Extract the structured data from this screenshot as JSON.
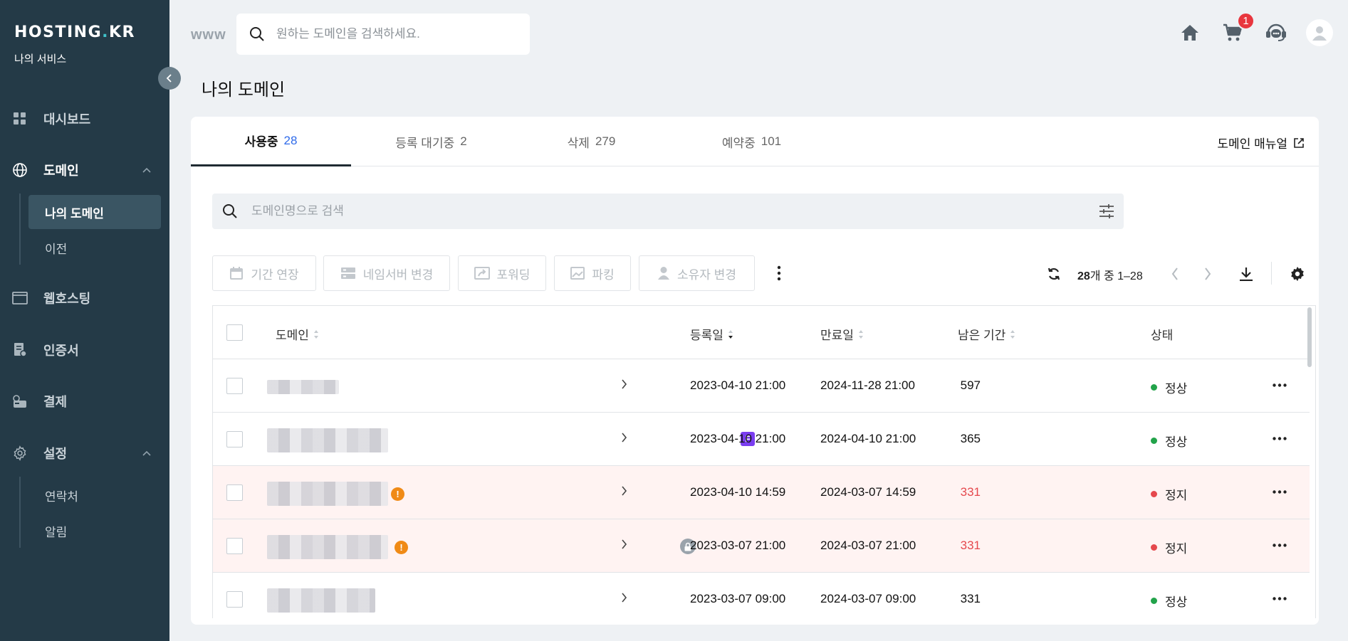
{
  "sidebar": {
    "logo": {
      "main": "HOSTING",
      "dot": ".",
      "tail": "KR"
    },
    "subtitle": "나의 서비스",
    "items": [
      {
        "label": "대시보드",
        "icon": "dashboard-icon"
      },
      {
        "label": "도메인",
        "icon": "globe-icon"
      },
      {
        "label": "웹호스팅",
        "icon": "browser-window-icon"
      },
      {
        "label": "인증서",
        "icon": "certificate-icon"
      },
      {
        "label": "결제",
        "icon": "payment-icon"
      },
      {
        "label": "설정",
        "icon": "gear-icon"
      }
    ],
    "domain_sub": [
      "나의 도메인",
      "이전"
    ],
    "settings_sub": [
      "연락처",
      "알림"
    ]
  },
  "topbar": {
    "www": "www",
    "search_placeholder": "원하는 도메인을 검색하세요.",
    "cart_count": "1"
  },
  "page_title": "나의 도메인",
  "tabs": [
    {
      "label": "사용중",
      "count": "28"
    },
    {
      "label": "등록 대기중",
      "count": "2"
    },
    {
      "label": "삭제",
      "count": "279"
    },
    {
      "label": "예약중",
      "count": "101"
    }
  ],
  "manual_link": "도메인 매뉴얼",
  "list_search_placeholder": "도메인명으로 검색",
  "actions": [
    "기간 연장",
    "네임서버 변경",
    "포워딩",
    "파킹",
    "소유자 변경"
  ],
  "pagination": {
    "total": "28",
    "total_suffix": "개 중 1–28"
  },
  "table": {
    "headers": {
      "domain": "도메인",
      "registered": "등록일",
      "expires": "만료일",
      "remaining": "남은 기간",
      "status": "상태"
    },
    "rows": [
      {
        "registered": "2023-04-10 21:00",
        "expires": "2024-11-28 21:00",
        "remaining": "597",
        "status": "정상"
      },
      {
        "registered": "2023-04-10 21:00",
        "expires": "2024-04-10 21:00",
        "remaining": "365",
        "status": "정상",
        "badge": "F"
      },
      {
        "registered": "2023-04-10 14:59",
        "expires": "2024-03-07 14:59",
        "remaining": "331",
        "status": "정지"
      },
      {
        "registered": "2023-03-07 21:00",
        "expires": "2024-03-07 21:00",
        "remaining": "331",
        "status": "정지"
      },
      {
        "registered": "2023-03-07 09:00",
        "expires": "2024-03-07 09:00",
        "remaining": "331",
        "status": "정상"
      }
    ]
  },
  "colors": {
    "sidebar": "#243a47",
    "accent": "#2f6bea",
    "ok": "#22a34a",
    "stopped": "#e5484d",
    "warning": "#f08a16",
    "badge": "#7a3df0"
  }
}
